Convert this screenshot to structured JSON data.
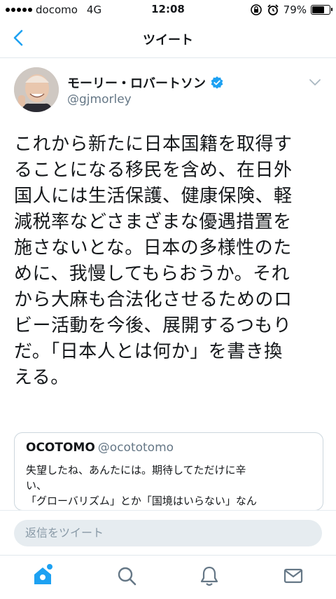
{
  "status_bar": {
    "carrier": "docomo",
    "network": "4G",
    "time": "12:08",
    "battery_percent": "79%",
    "battery_level": 0.79
  },
  "nav": {
    "title": "ツイート"
  },
  "tweet": {
    "display_name": "モーリー・ロバートソン",
    "handle": "@gjmorley",
    "verified": true,
    "text": "これから新たに日本国籍を取得す\nることになる移民を含め、在日外\n国人には生活保護、健康保険、軽\n減税率などさまざまな優遇措置を\n施さないとな。日本の多様性のた\nめに、我慢してもらおうか。それ\nから大麻も合法化させるためのロ\nビー活動を今後、展開するつもり\nだ。「日本人とは何か」を書き換\nえる。"
  },
  "quote": {
    "name": "OCOTOMO",
    "handle": "@ocototomo",
    "text": "失望したね、あんたには。期待してただけに辛\nい、\n「グローバリズム」とか「国境はいらない」なん"
  },
  "reply": {
    "placeholder": "返信をツイート"
  },
  "tabs": [
    "home-icon",
    "search-icon",
    "notifications-icon",
    "messages-icon"
  ],
  "colors": {
    "accent": "#1da1f2",
    "muted": "#657786",
    "text": "#14171a"
  }
}
